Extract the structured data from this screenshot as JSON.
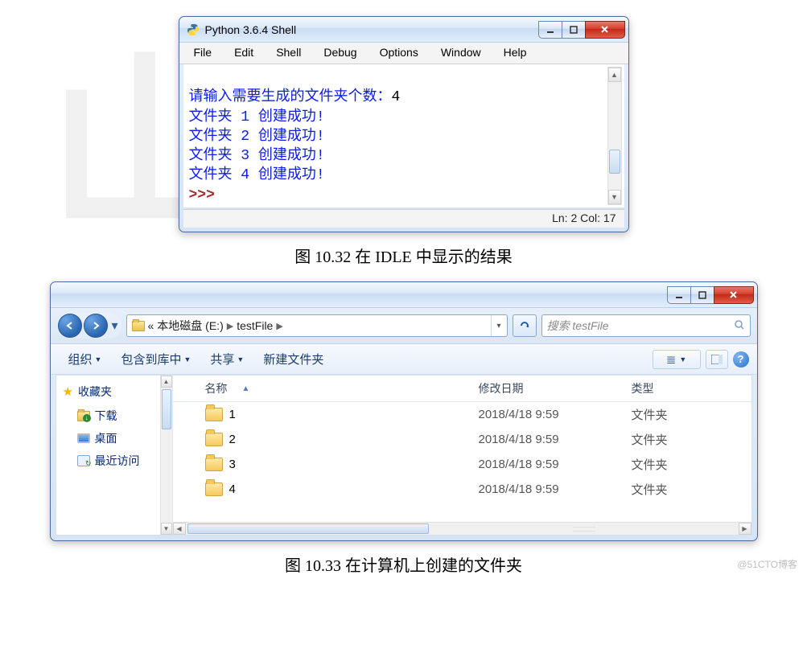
{
  "idle": {
    "title": "Python 3.6.4 Shell",
    "menu": [
      "File",
      "Edit",
      "Shell",
      "Debug",
      "Options",
      "Window",
      "Help"
    ],
    "lines": [
      {
        "prompt": "请输入需要生成的文件夹个数：",
        "input": "4"
      },
      {
        "text": "文件夹 1 创建成功!"
      },
      {
        "text": "文件夹 2 创建成功!"
      },
      {
        "text": "文件夹 3 创建成功!"
      },
      {
        "text": "文件夹 4 创建成功!"
      }
    ],
    "prompt_symbol": ">>> ",
    "status": "Ln: 2   Col: 17"
  },
  "caption1": "图 10.32    在 IDLE 中显示的结果",
  "explorer": {
    "breadcrumb_prefix": "«",
    "breadcrumb_parts": [
      "本地磁盘 (E:)",
      "testFile"
    ],
    "search_placeholder": "搜索 testFile",
    "toolbar": {
      "organize": "组织",
      "include": "包含到库中",
      "share": "共享",
      "new_folder": "新建文件夹"
    },
    "sidebar": {
      "favorites": "收藏夹",
      "downloads": "下载",
      "desktop": "桌面",
      "recent": "最近访问"
    },
    "columns": {
      "name": "名称",
      "date": "修改日期",
      "type": "类型"
    },
    "rows": [
      {
        "name": "1",
        "date": "2018/4/18 9:59",
        "type": "文件夹"
      },
      {
        "name": "2",
        "date": "2018/4/18 9:59",
        "type": "文件夹"
      },
      {
        "name": "3",
        "date": "2018/4/18 9:59",
        "type": "文件夹"
      },
      {
        "name": "4",
        "date": "2018/4/18 9:59",
        "type": "文件夹"
      }
    ]
  },
  "caption2": "图 10.33    在计算机上创建的文件夹",
  "watermark": "@51CTO博客"
}
